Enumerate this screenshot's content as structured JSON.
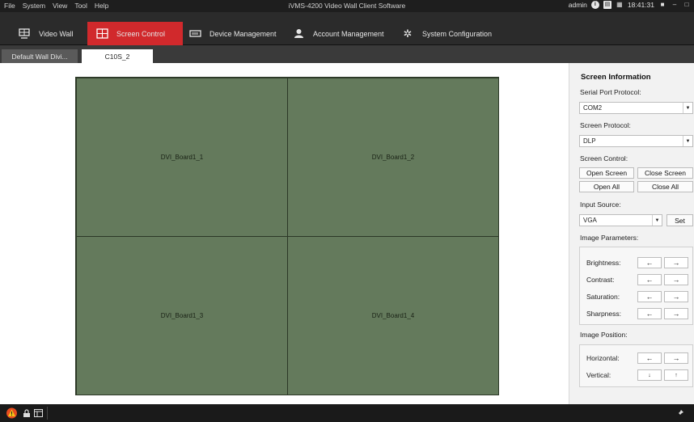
{
  "menu": [
    "File",
    "System",
    "View",
    "Tool",
    "Help"
  ],
  "app_title": "iVMS-4200 Video Wall Client Software",
  "titlebar": {
    "user": "admin",
    "time": "18:41:31"
  },
  "nav_tabs": [
    {
      "label": "Video Wall",
      "icon": "video-wall-icon",
      "active": false
    },
    {
      "label": "Screen Control",
      "icon": "screen-control-icon",
      "active": true
    },
    {
      "label": "Device Management",
      "icon": "device-management-icon",
      "active": false
    },
    {
      "label": "Account Management",
      "icon": "account-icon",
      "active": false
    },
    {
      "label": "System Configuration",
      "icon": "gear-icon",
      "active": false
    }
  ],
  "sub_tabs": [
    {
      "label": "Default Wall Divi...",
      "active": false
    },
    {
      "label": "C10S_2",
      "active": true
    }
  ],
  "wall": {
    "cells": [
      "DVI_Board1_1",
      "DVI_Board1_2",
      "DVI_Board1_3",
      "DVI_Board1_4"
    ]
  },
  "panel": {
    "title": "Screen Information",
    "serial_label": "Serial Port Protocol:",
    "serial_value": "COM2",
    "screen_protocol_label": "Screen Protocol:",
    "screen_protocol_value": "DLP",
    "screen_control_label": "Screen Control:",
    "open_screen": "Open Screen",
    "close_screen": "Close Screen",
    "open_all": "Open All",
    "close_all": "Close All",
    "input_source_label": "Input Source:",
    "input_source_value": "VGA",
    "set": "Set",
    "image_params_label": "Image Parameters:",
    "brightness": "Brightness:",
    "contrast": "Contrast:",
    "saturation": "Saturation:",
    "sharpness": "Sharpness:",
    "image_position_label": "Image Position:",
    "horizontal": "Horizontal:",
    "vertical": "Vertical:",
    "arrow_left": "←",
    "arrow_right": "→",
    "arrow_down": "↓",
    "arrow_up": "↑"
  },
  "colors": {
    "active_tab": "#d1292c",
    "wall_fill": "#647a5c",
    "alarm": "#f0a020"
  }
}
